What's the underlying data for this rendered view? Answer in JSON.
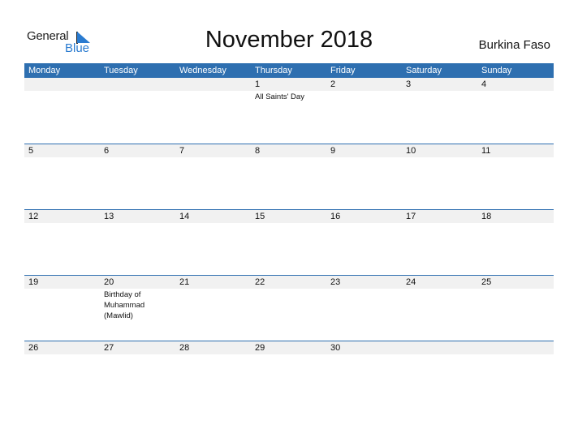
{
  "logo": {
    "line1": "General",
    "line2": "Blue",
    "color": "#2a7bd0"
  },
  "title": "November 2018",
  "country": "Burkina Faso",
  "header_color": "#2e6fb0",
  "weekdays": [
    "Monday",
    "Tuesday",
    "Wednesday",
    "Thursday",
    "Friday",
    "Saturday",
    "Sunday"
  ],
  "weeks": [
    [
      {
        "day": "",
        "holiday": ""
      },
      {
        "day": "",
        "holiday": ""
      },
      {
        "day": "",
        "holiday": ""
      },
      {
        "day": "1",
        "holiday": "All Saints' Day"
      },
      {
        "day": "2",
        "holiday": ""
      },
      {
        "day": "3",
        "holiday": ""
      },
      {
        "day": "4",
        "holiday": ""
      }
    ],
    [
      {
        "day": "5",
        "holiday": ""
      },
      {
        "day": "6",
        "holiday": ""
      },
      {
        "day": "7",
        "holiday": ""
      },
      {
        "day": "8",
        "holiday": ""
      },
      {
        "day": "9",
        "holiday": ""
      },
      {
        "day": "10",
        "holiday": ""
      },
      {
        "day": "11",
        "holiday": ""
      }
    ],
    [
      {
        "day": "12",
        "holiday": ""
      },
      {
        "day": "13",
        "holiday": ""
      },
      {
        "day": "14",
        "holiday": ""
      },
      {
        "day": "15",
        "holiday": ""
      },
      {
        "day": "16",
        "holiday": ""
      },
      {
        "day": "17",
        "holiday": ""
      },
      {
        "day": "18",
        "holiday": ""
      }
    ],
    [
      {
        "day": "19",
        "holiday": ""
      },
      {
        "day": "20",
        "holiday": "Birthday of Muhammad (Mawlid)"
      },
      {
        "day": "21",
        "holiday": ""
      },
      {
        "day": "22",
        "holiday": ""
      },
      {
        "day": "23",
        "holiday": ""
      },
      {
        "day": "24",
        "holiday": ""
      },
      {
        "day": "25",
        "holiday": ""
      }
    ],
    [
      {
        "day": "26",
        "holiday": ""
      },
      {
        "day": "27",
        "holiday": ""
      },
      {
        "day": "28",
        "holiday": ""
      },
      {
        "day": "29",
        "holiday": ""
      },
      {
        "day": "30",
        "holiday": ""
      },
      {
        "day": "",
        "holiday": ""
      },
      {
        "day": "",
        "holiday": ""
      }
    ]
  ]
}
